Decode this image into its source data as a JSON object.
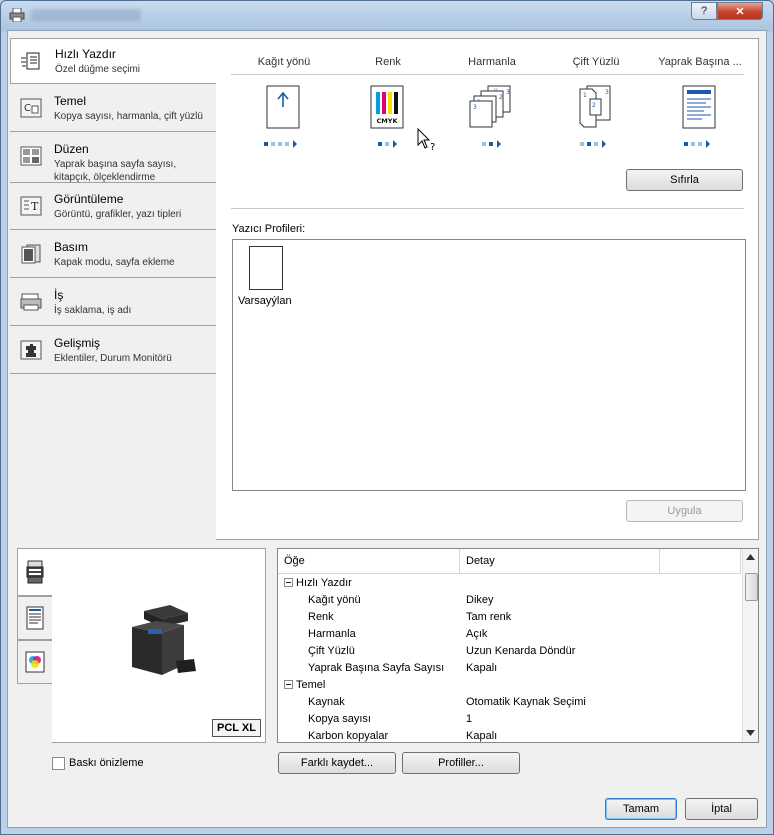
{
  "window": {
    "title": ""
  },
  "titlebar": {
    "help": "?",
    "close": "✕"
  },
  "nav": {
    "items": [
      {
        "title": "Hızlı Yazdır",
        "sub": "Özel düğme seçimi",
        "icon": "quick-print-icon"
      },
      {
        "title": "Temel",
        "sub": "Kopya sayısı, harmanla, çift yüzlü",
        "icon": "basic-icon"
      },
      {
        "title": "Düzen",
        "sub": "Yaprak başına sayfa sayısı, kitapçık, ölçeklendirme",
        "icon": "layout-icon"
      },
      {
        "title": "Görüntüleme",
        "sub": "Görüntü, grafikler, yazı tipleri",
        "icon": "imaging-icon"
      },
      {
        "title": "Basım",
        "sub": "Kapak modu, sayfa ekleme",
        "icon": "publishing-icon"
      },
      {
        "title": "İş",
        "sub": "İş saklama, iş adı",
        "icon": "job-icon"
      },
      {
        "title": "Gelişmiş",
        "sub": "Eklentiler, Durum Monitörü",
        "icon": "advanced-icon"
      }
    ]
  },
  "quick": {
    "columns": [
      {
        "label": "Kağıt yönü",
        "icon": "orientation-icon"
      },
      {
        "label": "Renk",
        "icon": "color-cmyk-icon"
      },
      {
        "label": "Harmanla",
        "icon": "collate-icon"
      },
      {
        "label": "Çift Yüzlü",
        "icon": "duplex-icon"
      },
      {
        "label": "Yaprak Başına ...",
        "icon": "pages-per-sheet-icon"
      }
    ],
    "cmyk_text": "CMYK",
    "reset_label": "Sıfırla",
    "profiles_label": "Yazıcı Profileri:",
    "profile_name": "Varsayýlan",
    "apply_label": "Uygula"
  },
  "preview": {
    "pdl_badge": "PCL XL"
  },
  "tree": {
    "col_item": "Öğe",
    "col_detail": "Detay",
    "rows": [
      {
        "key": "Hızlı Yazdır",
        "value": "",
        "group": true
      },
      {
        "key": "Kağıt yönü",
        "value": "Dikey"
      },
      {
        "key": "Renk",
        "value": "Tam renk"
      },
      {
        "key": "Harmanla",
        "value": "Açık"
      },
      {
        "key": "Çift Yüzlü",
        "value": "Uzun Kenarda Döndür"
      },
      {
        "key": "Yaprak Başına Sayfa Sayısı",
        "value": "Kapalı"
      },
      {
        "key": "Temel",
        "value": "",
        "group": true
      },
      {
        "key": "Kaynak",
        "value": "Otomatik Kaynak Seçimi"
      },
      {
        "key": "Kopya sayısı",
        "value": "1"
      },
      {
        "key": "Karbon kopyalar",
        "value": "Kapalı"
      }
    ]
  },
  "bottom": {
    "preview_checkbox": "Baskı önizleme",
    "save_as": "Farklı kaydet...",
    "profiles": "Profiller...",
    "ok": "Tamam",
    "cancel": "İptal"
  },
  "colors": {
    "accent": "#2f7bd5",
    "cyan": "#00a0e0",
    "magenta": "#e0007a",
    "yellow": "#f5e000",
    "black": "#111111"
  }
}
